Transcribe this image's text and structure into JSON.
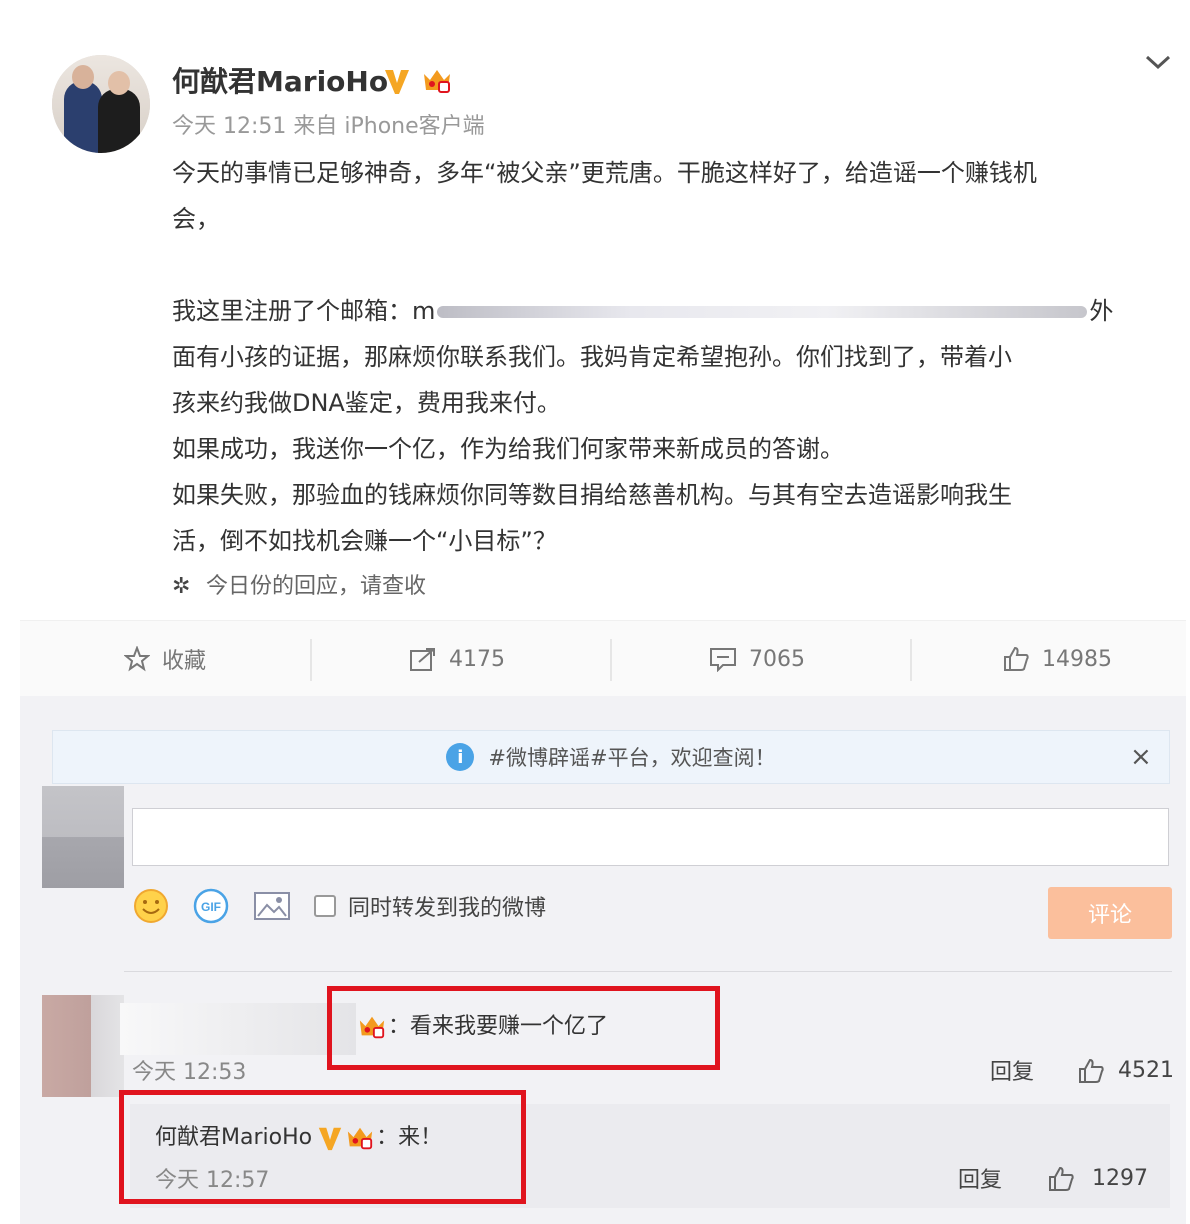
{
  "post": {
    "author_name": "何猷君MarioHo",
    "meta": "今天 12:51 来自 iPhone客户端",
    "lines": [
      "今天的事情已足够神奇，多年“被父亲”更荒唐。干脆这样好了，给造谣一个赚钱机",
      "会，",
      "",
      "我这里注册了个邮箱：m",
      "面有小孩的证据，那麻烦你联系我们。我妈肯定希望抱孙。你们找到了，带着小",
      "孩来约我做DNA鉴定，费用我来付。",
      "如果成功，我送你一个亿，作为给我们何家带来新成员的答谢。",
      "如果失败，那验血的钱麻烦你同等数目捐给慈善机构。与其有空去造谣影响我生",
      "活，倒不如找机会赚一个“小目标”？"
    ],
    "email_line_suffix": "外",
    "source_text": "今日份的回应，请查收",
    "colors": {
      "highlight": "#e0141e",
      "comment_button": "#fbbf9c",
      "info": "#4aa3e6"
    }
  },
  "actions": {
    "favorite_label": "收藏",
    "repost_count": "4175",
    "comment_count": "7065",
    "like_count": "14985"
  },
  "notice": {
    "text": "#微博辟谣#平台，欢迎查阅！",
    "close": "×"
  },
  "composer": {
    "input_value": "",
    "icons": [
      "smiley-icon",
      "gif-icon",
      "image-icon"
    ],
    "gif_label": "GIF",
    "checkbox_label": "同时转发到我的微博",
    "submit_label": "评论"
  },
  "comments": [
    {
      "text": "：看来我要赚一个亿了",
      "time": "今天 12:53",
      "reply_label": "回复",
      "likes": "4521"
    }
  ],
  "reply": {
    "author_name": "何猷君MarioHo",
    "text": "：来！",
    "time": "今天 12:57",
    "reply_label": "回复",
    "likes": "1297"
  }
}
